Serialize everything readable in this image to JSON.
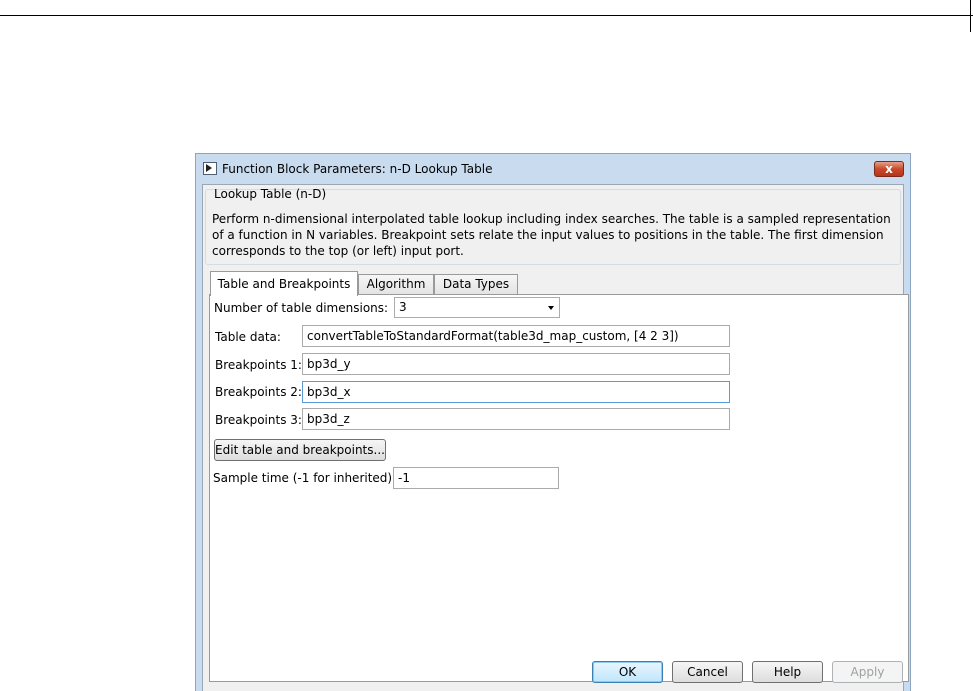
{
  "window": {
    "title": "Function Block Parameters: n-D Lookup Table",
    "close_label": "x"
  },
  "description": {
    "group_title": "Lookup Table (n-D)",
    "text": "Perform n-dimensional interpolated table lookup including index searches. The table is a sampled representation of a function in N variables. Breakpoint sets relate the input values to positions in the table. The first dimension corresponds to the top (or left) input port."
  },
  "tabs": [
    {
      "label": "Table and Breakpoints",
      "active": true
    },
    {
      "label": "Algorithm",
      "active": false
    },
    {
      "label": "Data Types",
      "active": false
    }
  ],
  "form": {
    "dimensions_label": "Number of table dimensions:",
    "dimensions_value": "3",
    "table_data_label": "Table data:",
    "table_data_value": "convertTableToStandardFormat(table3d_map_custom, [4 2 3])",
    "bp1_label": "Breakpoints 1:",
    "bp1_value": "bp3d_y",
    "bp2_label": "Breakpoints 2:",
    "bp2_value": "bp3d_x",
    "bp3_label": "Breakpoints 3:",
    "bp3_value": "bp3d_z",
    "edit_button": "Edit table and breakpoints...",
    "sample_time_label": "Sample time (-1 for inherited):",
    "sample_time_value": "-1"
  },
  "buttons": {
    "ok": "OK",
    "cancel": "Cancel",
    "help": "Help",
    "apply": "Apply"
  }
}
